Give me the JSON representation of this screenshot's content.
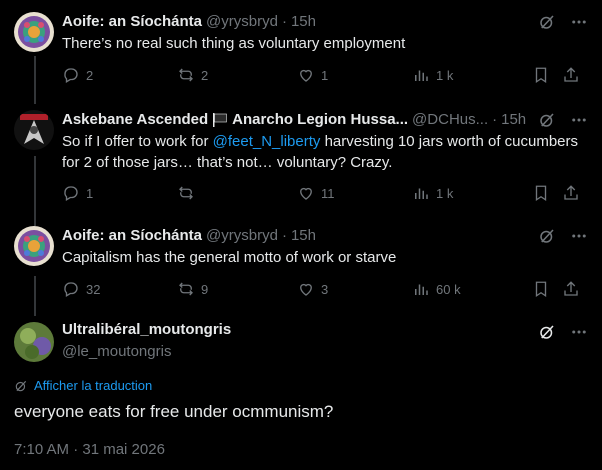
{
  "tweets": [
    {
      "name": "Aoife: an Síochánta",
      "handle": "@yrysbryd",
      "sep": "·",
      "time": "15h",
      "text": "There’s  no real such thing as voluntary  employment",
      "replies": "2",
      "retweets": "2",
      "likes": "1",
      "views": "1 k"
    },
    {
      "name": "Askebane Ascended",
      "name_suffix": "Anarcho Legion Hussa...",
      "handle": "@DCHus...",
      "sep": "·",
      "time": "15h",
      "text_before": "So if I offer to work for ",
      "mention": "@feet_N_liberty",
      "text_after": " harvesting 10 jars worth of cucumbers for 2 of those jars… that’s not… voluntary? Crazy.",
      "replies": "1",
      "retweets": "",
      "likes": "11",
      "views": "1 k"
    },
    {
      "name": "Aoife: an Síochánta",
      "handle": "@yrysbryd",
      "sep": "·",
      "time": "15h",
      "text": "Capitalism has the general motto of work or starve",
      "replies": "32",
      "retweets": "9",
      "likes": "3",
      "views": "60 k"
    }
  ],
  "main_tweet": {
    "name": "Ultralibéral_moutongris",
    "handle": "@le_moutongris",
    "translate_label": "Afficher la traduction",
    "text": "everyone eats for free under ocmmunism?",
    "timestamp": "7:10 AM · 31 mai 2026"
  },
  "colors": {
    "background": "#000000",
    "text": "#e7e9ea",
    "muted": "#71767b",
    "link": "#1d9bf0",
    "thread_line": "#333639"
  }
}
